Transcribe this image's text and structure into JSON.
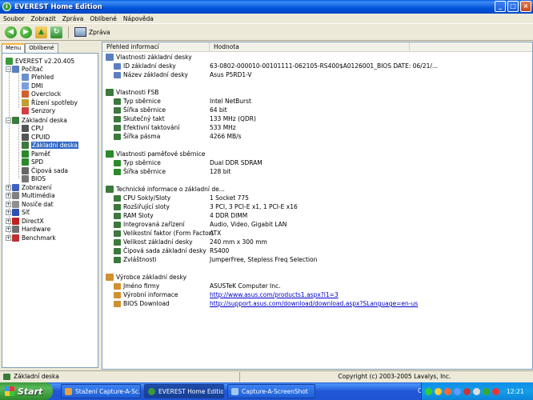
{
  "window": {
    "title": "EVEREST Home Edition",
    "icon": "i"
  },
  "menu": [
    "Soubor",
    "Zobrazit",
    "Zpráva",
    "Oblíbené",
    "Nápověda"
  ],
  "toolbar": {
    "report_label": "Zpráva"
  },
  "tabs": [
    "Menu",
    "Oblíbené"
  ],
  "tree": [
    {
      "label": "EVEREST v2.20.405",
      "icon": "info-icon",
      "color": "#3a9a3a"
    },
    {
      "label": "Počítač",
      "icon": "computer-icon",
      "color": "#5a7fc0"
    },
    {
      "label": "Přehled",
      "icon": "overview-icon",
      "color": "#6a8fd0"
    },
    {
      "label": "DMI",
      "icon": "dmi-icon",
      "color": "#7a9fe0"
    },
    {
      "label": "Overclock",
      "icon": "overclock-icon",
      "color": "#d06030"
    },
    {
      "label": "Řízení spotřeby",
      "icon": "power-icon",
      "color": "#c0a030"
    },
    {
      "label": "Senzory",
      "icon": "sensor-icon",
      "color": "#d04040"
    },
    {
      "label": "Základní deska",
      "icon": "motherboard-icon",
      "color": "#3a7a3a"
    },
    {
      "label": "CPU",
      "icon": "cpu-icon",
      "color": "#555555"
    },
    {
      "label": "CPUID",
      "icon": "cpuid-icon",
      "color": "#555555"
    },
    {
      "label": "Základní deska",
      "icon": "motherboard-icon",
      "color": "#3a7a3a"
    },
    {
      "label": "Paměť",
      "icon": "memory-icon",
      "color": "#2a8a2a"
    },
    {
      "label": "SPD",
      "icon": "spd-icon",
      "color": "#2a8a2a"
    },
    {
      "label": "Čipová sada",
      "icon": "chipset-icon",
      "color": "#666666"
    },
    {
      "label": "BIOS",
      "icon": "bios-icon",
      "color": "#777777"
    },
    {
      "label": "Zobrazení",
      "icon": "display-icon",
      "color": "#4060c0"
    },
    {
      "label": "Multimédia",
      "icon": "multimedia-icon",
      "color": "#808080"
    },
    {
      "label": "Nosiče dat",
      "icon": "storage-icon",
      "color": "#909090"
    },
    {
      "label": "Síť",
      "icon": "network-icon",
      "color": "#3050b0"
    },
    {
      "label": "DirectX",
      "icon": "directx-icon",
      "color": "#c02020"
    },
    {
      "label": "Hardware",
      "icon": "hardware-icon",
      "color": "#707070"
    },
    {
      "label": "Benchmark",
      "icon": "benchmark-icon",
      "color": "#c03030"
    }
  ],
  "columns": [
    "Přehled informací",
    "Hodnota"
  ],
  "sections": [
    {
      "title": "Vlastnosti základní desky",
      "items": [
        {
          "name": "ID základní desky",
          "value": "63-0802-000010-00101111-062105-RS400$A0126001_BIOS DATE: 06/21/..."
        },
        {
          "name": "Název základní desky",
          "value": "Asus P5RD1-V"
        }
      ]
    },
    {
      "title": "Vlastnosti FSB",
      "items": [
        {
          "name": "Typ sběrnice",
          "value": "Intel NetBurst"
        },
        {
          "name": "Šířka sběrnice",
          "value": "64 bit"
        },
        {
          "name": "Skutečný takt",
          "value": "133 MHz (QDR)"
        },
        {
          "name": "Efektivní taktování",
          "value": "533 MHz"
        },
        {
          "name": "Šířka pásma",
          "value": "4266 MB/s"
        }
      ]
    },
    {
      "title": "Vlastnosti paměťové sběrnice",
      "items": [
        {
          "name": "Typ sběrnice",
          "value": "Dual DDR SDRAM"
        },
        {
          "name": "Šířka sběrnice",
          "value": "128 bit"
        }
      ]
    },
    {
      "title": "Technické informace o základní de...",
      "items": [
        {
          "name": "CPU Sokly/Sloty",
          "value": "1 Socket 775"
        },
        {
          "name": "Rozšiřující sloty",
          "value": "3 PCI, 3 PCI-E x1, 1 PCI-E x16"
        },
        {
          "name": "RAM Sloty",
          "value": "4 DDR DIMM"
        },
        {
          "name": "Integrovaná zařízení",
          "value": "Audio, Video, Gigabit LAN"
        },
        {
          "name": "Velikostní faktor (Form Factor)",
          "value": "ATX"
        },
        {
          "name": "Velikost základní desky",
          "value": "240 mm x 300 mm"
        },
        {
          "name": "Čipová sada základní desky",
          "value": "RS400"
        },
        {
          "name": "Zvláštnosti",
          "value": "JumperFree, Stepless Freq Selection"
        }
      ]
    },
    {
      "title": "Výrobce základní desky",
      "items": [
        {
          "name": "Jméno firmy",
          "value": "ASUSTeK Computer Inc."
        },
        {
          "name": "Výrobní informace",
          "value": "http://www.asus.com/products1.aspx?l1=3",
          "link": true
        },
        {
          "name": "BIOS Download",
          "value": "http://support.asus.com/download/download.aspx?SLanguage=en-us",
          "link": true
        }
      ]
    }
  ],
  "status": {
    "left": "Základní deska",
    "right": "Copyright (c) 2003-2005 Lavalys, Inc."
  },
  "taskbar": {
    "start": "Start",
    "tasks": [
      "Stažení Capture-A-Sc...",
      "EVEREST Home Edition",
      "Capture-A-ScreenShot"
    ],
    "lang": "CS",
    "clock": "12:21"
  }
}
